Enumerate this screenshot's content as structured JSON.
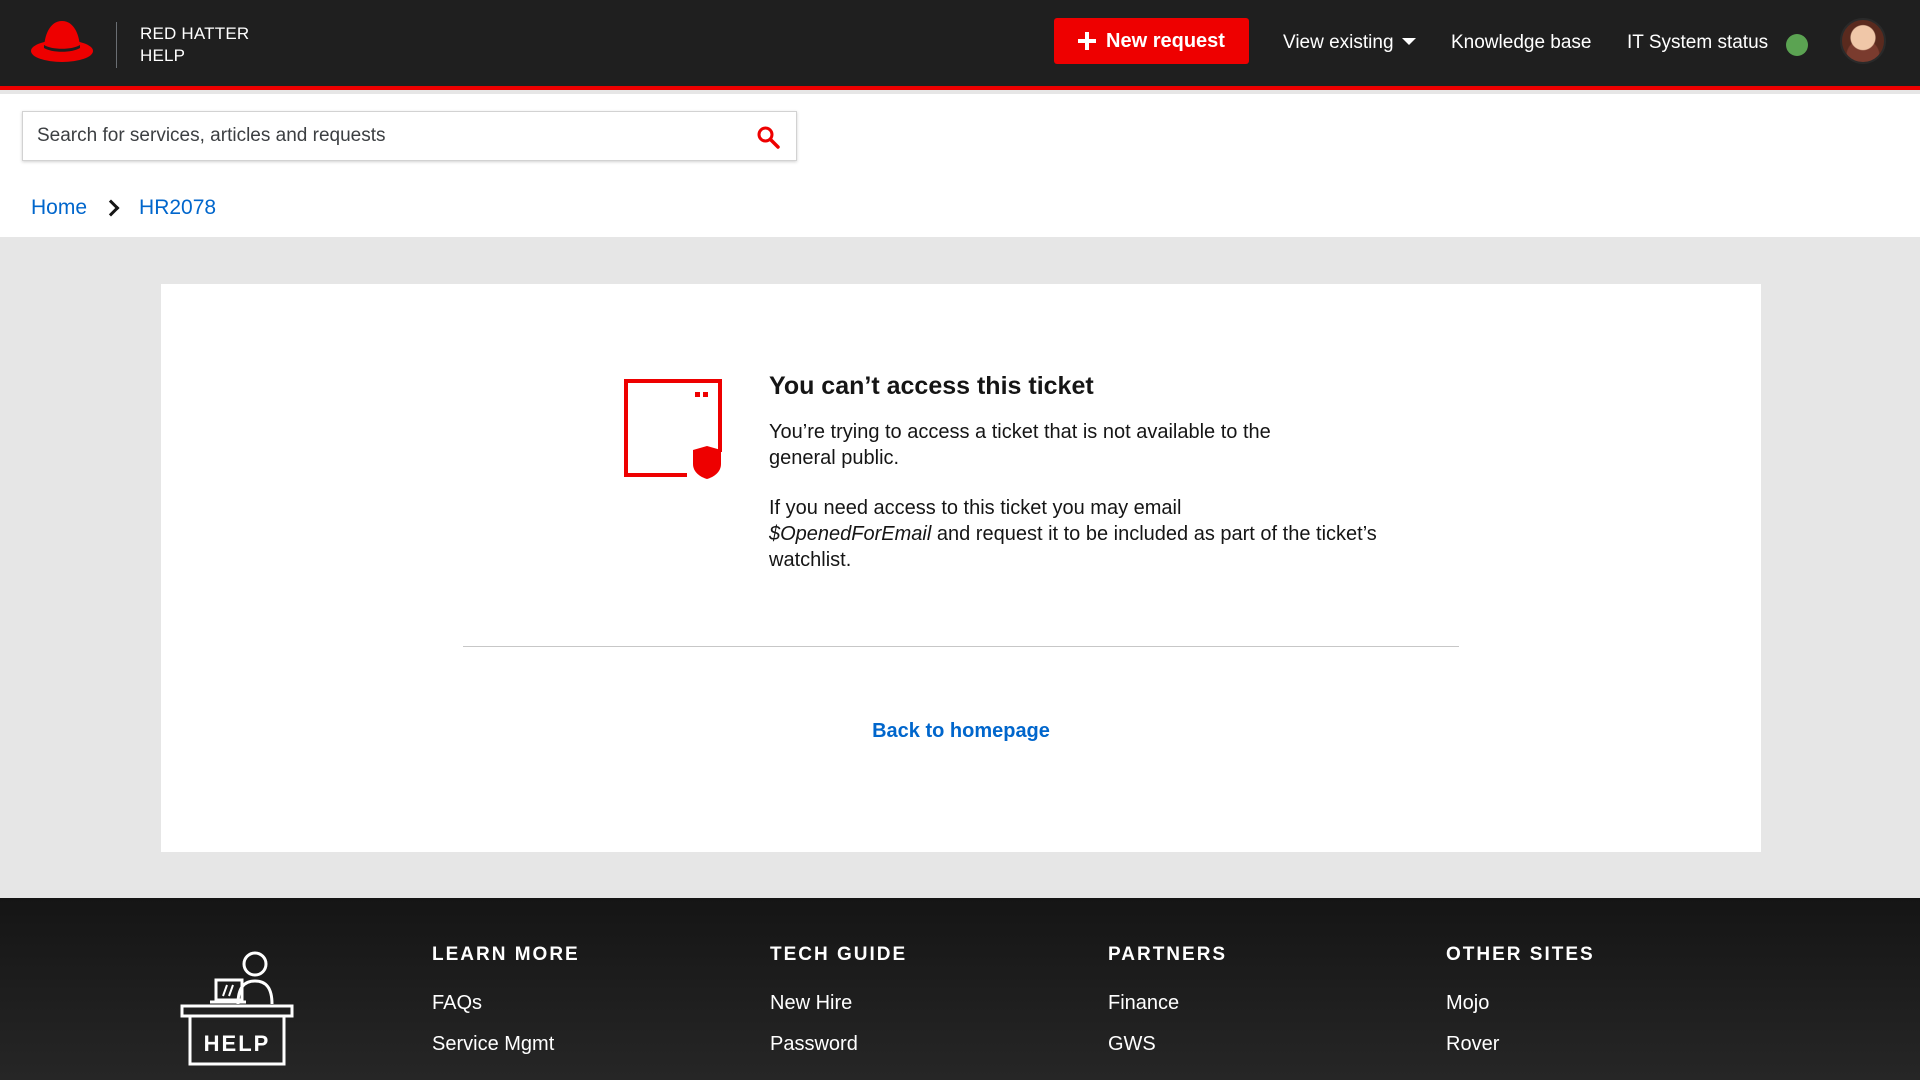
{
  "header": {
    "brand_line1": "RED HATTER",
    "brand_line2": "HELP",
    "new_request_label": "New request",
    "nav": {
      "view_existing": "View existing",
      "knowledge_base": "Knowledge base",
      "it_system_status": "IT System status"
    },
    "status_color": "#5ba352",
    "accent_color": "#ee0000"
  },
  "search": {
    "placeholder": "Search for services, articles and requests",
    "value": ""
  },
  "breadcrumb": {
    "items": [
      "Home",
      "HR2078"
    ]
  },
  "message": {
    "title": "You can’t access this ticket",
    "p1": "You’re trying to access a ticket that is not available to the general public.",
    "p2_before": "If you need access to this ticket you may email",
    "p2_email": "$OpenedForEmail",
    "p2_after": "and request it to be included as part of the ticket’s watchlist.",
    "back_link": "Back to homepage"
  },
  "footer": {
    "help_sign": "HELP",
    "columns": [
      {
        "heading": "LEARN MORE",
        "links": [
          "FAQs",
          "Service Mgmt"
        ]
      },
      {
        "heading": "TECH GUIDE",
        "links": [
          "New Hire",
          "Password"
        ]
      },
      {
        "heading": "PARTNERS",
        "links": [
          "Finance",
          "GWS"
        ]
      },
      {
        "heading": "OTHER SITES",
        "links": [
          "Mojo",
          "Rover"
        ]
      }
    ]
  }
}
